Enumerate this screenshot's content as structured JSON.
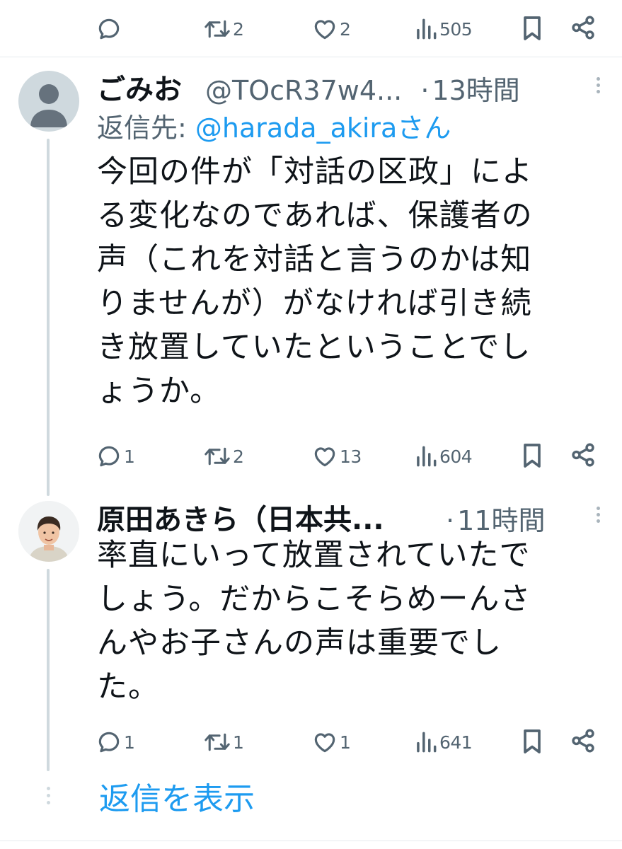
{
  "top_actions": {
    "reply": "",
    "retweet": "2",
    "like": "2",
    "views": "505"
  },
  "reply1": {
    "name": "ごみお",
    "handle": "@TOcR37w4...",
    "sep": "·",
    "time": "13時間",
    "replying_prefix": "返信先: ",
    "replying_to": "@harada_akiraさん",
    "lines": [
      "今回の件が「対話の区政」によ",
      "る変化なのであれば、保護者の",
      "声（これを対話と言うのかは知",
      "りませんが）がなければ引き続",
      "き放置していたということでし",
      "ょうか。"
    ],
    "actions": {
      "reply": "1",
      "retweet": "2",
      "like": "13",
      "views": "604"
    }
  },
  "reply2": {
    "name": "原田あきら（日本共...",
    "sep": "·",
    "time": "11時間",
    "lines": [
      "率直にいって放置されていたで",
      "しょう。だからこそらめーんさ",
      "んやお子さんの声は重要でし",
      "た。"
    ],
    "actions": {
      "reply": "1",
      "retweet": "1",
      "like": "1",
      "views": "641"
    }
  },
  "show_replies": "返信を表示",
  "colors": {
    "text": "#0f1419",
    "muted": "#536471",
    "link": "#1d9bf0",
    "line": "#cfd9de"
  },
  "icons": [
    "reply-icon",
    "retweet-icon",
    "like-icon",
    "views-icon",
    "bookmark-icon",
    "share-icon",
    "more-icon"
  ]
}
